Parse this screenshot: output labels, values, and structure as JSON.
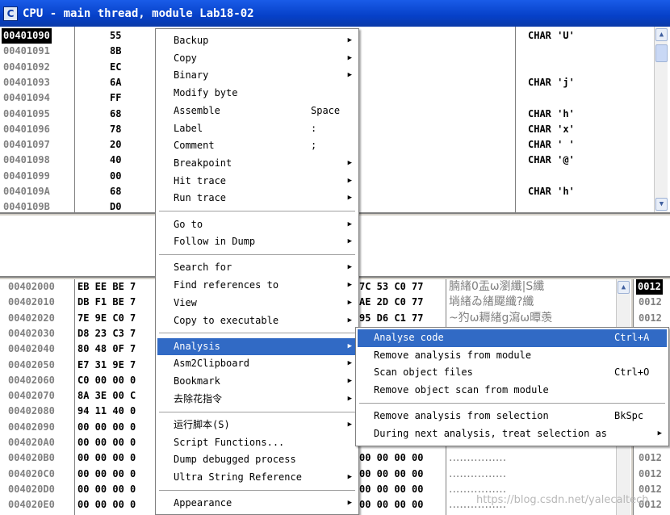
{
  "window": {
    "title": "CPU - main thread, module Lab18-02",
    "icon": "C"
  },
  "cpu": {
    "rows": [
      {
        "addr": "00401090",
        "hex": "55",
        "comment": "CHAR 'U'"
      },
      {
        "addr": "00401091",
        "hex": "8B",
        "comment": ""
      },
      {
        "addr": "00401092",
        "hex": "EC",
        "comment": ""
      },
      {
        "addr": "00401093",
        "hex": "6A",
        "comment": "CHAR 'j'"
      },
      {
        "addr": "00401094",
        "hex": "FF",
        "comment": ""
      },
      {
        "addr": "00401095",
        "hex": "68",
        "comment": "CHAR 'h'"
      },
      {
        "addr": "00401096",
        "hex": "78",
        "comment": "CHAR 'x'"
      },
      {
        "addr": "00401097",
        "hex": "20",
        "comment": "CHAR ' '"
      },
      {
        "addr": "00401098",
        "hex": "40",
        "comment": "CHAR '@'"
      },
      {
        "addr": "00401099",
        "hex": "00",
        "comment": ""
      },
      {
        "addr": "0040109A",
        "hex": "68",
        "comment": "CHAR 'h'"
      },
      {
        "addr": "0040109B",
        "hex": "D0",
        "comment": ""
      }
    ]
  },
  "dump": {
    "rows": [
      {
        "addr": "00402000",
        "hex": "EB EE BE 7",
        "hex2": "7C 53 C0 77",
        "ascii": "腩緖0盂ω瀏纖|S纖"
      },
      {
        "addr": "00402010",
        "hex": "DB F1 BE 7",
        "hex2": "AE 2D C0 77",
        "ascii": "埫緖ゐ緖飋纖?纖"
      },
      {
        "addr": "00402020",
        "hex": "7E 9E C0 7",
        "hex2": "95 D6 C1 77",
        "ascii": "~犳ω耨緖g瀉ω曋羡"
      },
      {
        "addr": "00402030",
        "hex": "D8 23 C3 7",
        "hex2": "",
        "ascii": ""
      },
      {
        "addr": "00402040",
        "hex": "80 48 0F 7",
        "hex2": "",
        "ascii": ""
      },
      {
        "addr": "00402050",
        "hex": "E7 31 9E 7",
        "hex2": "",
        "ascii": ""
      },
      {
        "addr": "00402060",
        "hex": "C0 00 00 0",
        "hex2": "",
        "ascii": ""
      },
      {
        "addr": "00402070",
        "hex": "8A 3E 00 C",
        "hex2": "",
        "ascii": ""
      },
      {
        "addr": "00402080",
        "hex": "94 11 40 0",
        "hex2": "",
        "ascii": ""
      },
      {
        "addr": "00402090",
        "hex": "00 00 00 0",
        "hex2": "",
        "ascii": ""
      },
      {
        "addr": "004020A0",
        "hex": "00 00 00 0",
        "hex2": "",
        "ascii": ""
      },
      {
        "addr": "004020B0",
        "hex": "00 00 00 0",
        "hex2": "00 00 00 00",
        "ascii": "................"
      },
      {
        "addr": "004020C0",
        "hex": "00 00 00 0",
        "hex2": "00 00 00 00",
        "ascii": "................"
      },
      {
        "addr": "004020D0",
        "hex": "00 00 00 0",
        "hex2": "00 00 00 00",
        "ascii": "................"
      },
      {
        "addr": "004020E0",
        "hex": "00 00 00 0",
        "hex2": "00 00 00 00",
        "ascii": "................"
      }
    ]
  },
  "stack": {
    "rows": [
      "0012",
      "0012",
      "0012",
      "",
      "",
      "",
      "",
      "",
      "",
      "",
      "",
      "0012",
      "0012",
      "0012",
      "0012"
    ]
  },
  "context_menu": {
    "items": [
      {
        "label": "Backup",
        "shortcut": "",
        "arrow": true
      },
      {
        "label": "Copy",
        "shortcut": "",
        "arrow": true
      },
      {
        "label": "Binary",
        "shortcut": "",
        "arrow": true
      },
      {
        "label": "Modify byte",
        "shortcut": "",
        "arrow": false
      },
      {
        "label": "Assemble",
        "shortcut": "Space",
        "arrow": false
      },
      {
        "label": "Label",
        "shortcut": ":",
        "arrow": false
      },
      {
        "label": "Comment",
        "shortcut": ";",
        "arrow": false
      },
      {
        "label": "Breakpoint",
        "shortcut": "",
        "arrow": true
      },
      {
        "label": "Hit trace",
        "shortcut": "",
        "arrow": true
      },
      {
        "label": "Run trace",
        "shortcut": "",
        "arrow": true
      },
      {
        "label": "Go to",
        "shortcut": "",
        "arrow": true
      },
      {
        "label": "Follow in Dump",
        "shortcut": "",
        "arrow": true
      },
      {
        "label": "Search for",
        "shortcut": "",
        "arrow": true
      },
      {
        "label": "Find references to",
        "shortcut": "",
        "arrow": true
      },
      {
        "label": "View",
        "shortcut": "",
        "arrow": true
      },
      {
        "label": "Copy to executable",
        "shortcut": "",
        "arrow": true
      },
      {
        "label": "Analysis",
        "shortcut": "",
        "arrow": true
      },
      {
        "label": "Asm2Clipboard",
        "shortcut": "",
        "arrow": true
      },
      {
        "label": "Bookmark",
        "shortcut": "",
        "arrow": true
      },
      {
        "label": "去除花指令",
        "shortcut": "",
        "arrow": true
      },
      {
        "label": "运行脚本(S)",
        "shortcut": "",
        "arrow": true
      },
      {
        "label": "Script Functions...",
        "shortcut": "",
        "arrow": false
      },
      {
        "label": "Dump debugged process",
        "shortcut": "",
        "arrow": false
      },
      {
        "label": "Ultra String Reference",
        "shortcut": "",
        "arrow": true
      },
      {
        "label": "Appearance",
        "shortcut": "",
        "arrow": true
      }
    ]
  },
  "analysis_submenu": {
    "items": [
      {
        "label": "Analyse code",
        "shortcut": "Ctrl+A",
        "arrow": false
      },
      {
        "label": "Remove analysis from module",
        "shortcut": "",
        "arrow": false
      },
      {
        "label": "Scan object files",
        "shortcut": "Ctrl+O",
        "arrow": false
      },
      {
        "label": "Remove object scan from module",
        "shortcut": "",
        "arrow": false
      },
      {
        "label": "Remove analysis from selection",
        "shortcut": "BkSpc",
        "arrow": false
      },
      {
        "label": "During next analysis, treat selection as",
        "shortcut": "",
        "arrow": true
      }
    ]
  },
  "watermark": "https://blog.csdn.net/yalecaltech"
}
